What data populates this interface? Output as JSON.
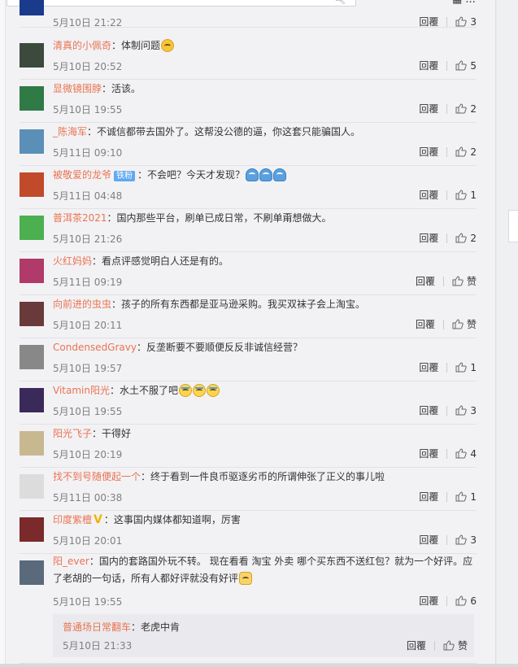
{
  "topbar": {
    "search_icon": "search-icon",
    "right_label": "..."
  },
  "like_empty": "赞",
  "reply_label": "回覆",
  "comments": [
    {
      "name": "",
      "text": "",
      "time": "5月10日 21:22",
      "likes": "3",
      "avatar_color": "#1a3a8c"
    },
    {
      "name": "清真的小佩奇",
      "text": "：体制问题",
      "time": "5月10日 20:52",
      "likes": "5",
      "avatar_color": "#3b4a3c",
      "emoji": [
        "think"
      ]
    },
    {
      "name": "显微镜围脖",
      "text": "：活该。",
      "time": "5月10日 19:55",
      "likes": "2",
      "avatar_color": "#2f7a45"
    },
    {
      "name": "_陈海军",
      "text": "：不诚信都带去国外了。这帮没公德的逼，你这套只能骗国人。",
      "time": "5月11日 09:10",
      "likes": "2",
      "avatar_color": "#5a8fb8"
    },
    {
      "name": "被敬爱的龙爷",
      "badge": "铁粉",
      "text": "：不会吧？今天才发现？",
      "time": "5月11日 04:48",
      "likes": "1",
      "avatar_color": "#c04a2a",
      "emoji": [
        "hug",
        "hug",
        "hug"
      ]
    },
    {
      "name": "普洱茶2021",
      "text": "：国内那些平台，刷单已成日常，不刷单甭想做大。",
      "time": "5月10日 21:26",
      "likes": "2",
      "avatar_color": "#4caf50"
    },
    {
      "name": "火红妈妈",
      "text": "：看点评感觉明白人还是有的。",
      "time": "5月11日 09:19",
      "likes": "赞",
      "avatar_color": "#b03a6a"
    },
    {
      "name": "向前进的虫虫",
      "text": "：孩子的所有东西都是亚马逊采购。我买双袜子会上淘宝。",
      "time": "5月10日 20:11",
      "likes": "赞",
      "avatar_color": "#6a3a3a"
    },
    {
      "name": "CondensedGravy",
      "text": "：反垄断要不要顺便反反非诚信经营？",
      "time": "5月10日 19:57",
      "likes": "1",
      "avatar_color": "#888888"
    },
    {
      "name": "Vitamin阳光",
      "text": "：水土不服了吧",
      "time": "5月10日 19:55",
      "likes": "3",
      "avatar_color": "#3a2a5a",
      "emoji": [
        "cry",
        "cry",
        "cry"
      ]
    },
    {
      "name": "阳光飞子",
      "text": "：干得好",
      "time": "5月10日 20:19",
      "likes": "4",
      "avatar_color": "#c8b890"
    },
    {
      "name": "找不到号随便起一个",
      "text": "：终于看到一件良币驱逐劣币的所谓伸张了正义的事儿啦",
      "time": "5月11日 00:38",
      "likes": "1",
      "avatar_color": "#dcdcdc"
    },
    {
      "name": "印度紫檀",
      "vip": "V",
      "text": "：这事国内媒体都知道啊，厉害",
      "time": "5月10日 20:01",
      "likes": "3",
      "avatar_color": "#7a2a2a"
    },
    {
      "name": "阳_ever",
      "text": "：国内的套路国外玩不转。  现在看看 淘宝 外卖 哪个买东西不送红包？就为一个好评。应了老胡的一句话，所有人都好评就没有好评",
      "time": "5月10日 19:55",
      "likes": "6",
      "avatar_color": "#5a6a7a",
      "emoji": [
        "cat"
      ]
    }
  ],
  "subreply": {
    "name": "普通场日常翻车",
    "text": "：老虎中肯",
    "time": "5月10日 21:33",
    "likes": "赞"
  }
}
